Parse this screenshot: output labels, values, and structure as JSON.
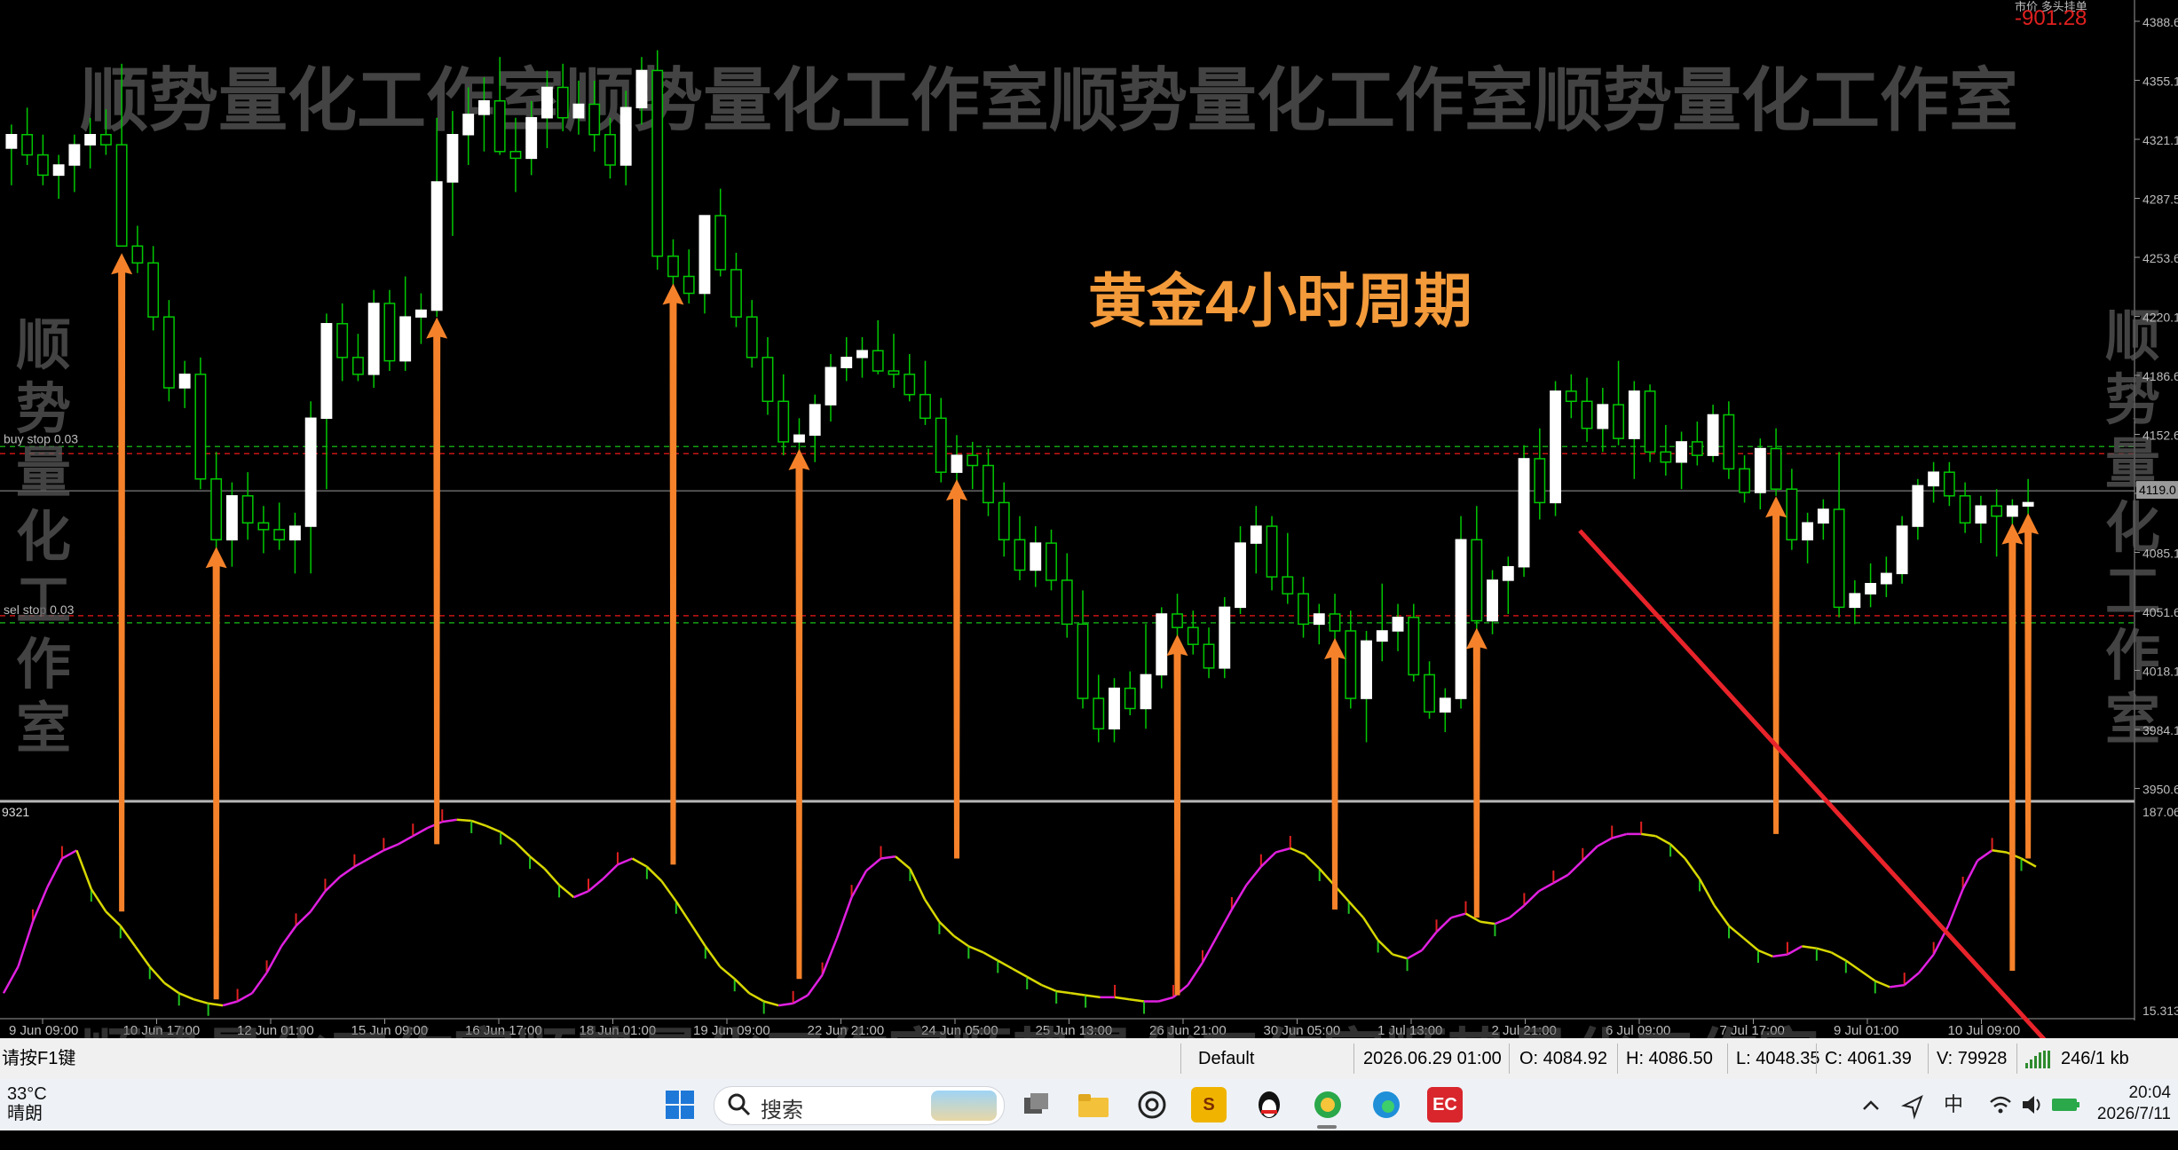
{
  "chart": {
    "title_annotation": "黄金4小时周期",
    "top_right_profit": "-901.28",
    "top_right_label": "市价 多头挂单",
    "order_lines": {
      "buy_stop": "buy stop 0.03",
      "sell_stop": "sel stop 0.03"
    },
    "indicator_label": "9321",
    "current_price_label": "4119.0",
    "watermark_text": "顺势量化工作室顺势量化工作室顺势量化工作室顺势量化工作室",
    "watermark_vertical_left": "顺势量化工作室",
    "watermark_vertical_right": "顺势量化工作室",
    "colors": {
      "bull": "#ffffff",
      "bear": "#00c800",
      "arrow": "#f5822a",
      "trend": "#e8232a",
      "ma_pink": "#e020e0",
      "ma_yellow": "#d7d700",
      "order_red": "#c81414",
      "order_green": "#14a014"
    }
  },
  "chart_data": {
    "type": "candlestick",
    "symbol": "黄金",
    "period": "H4",
    "price_axis_labels": [
      "4388.6",
      "4355.1",
      "4321.1",
      "4287.5",
      "4253.6",
      "4220.1",
      "4186.6",
      "4152.6",
      "4119.0",
      "4085.1",
      "4051.6",
      "4018.1",
      "3984.1",
      "3950.6"
    ],
    "indicator_axis_labels": [
      "187.06",
      "15.3137"
    ],
    "time_axis_labels": [
      "9 Jun 09:00",
      "10 Jun 17:00",
      "12 Jun 01:00",
      "15 Jun 09:00",
      "16 Jun 17:00",
      "18 Jun 01:00",
      "19 Jun 09:00",
      "22 Jun 21:00",
      "24 Jun 05:00",
      "25 Jun 13:00",
      "26 Jun 21:00",
      "30 Jun 05:00",
      "1 Jul 13:00",
      "2 Jul 21:00",
      "6 Jul 09:00",
      "7 Jul 17:00",
      "9 Jul 01:00",
      "10 Jul 09:00"
    ],
    "ylim": [
      3934,
      4394
    ],
    "current_price": 4119.0,
    "buy_stop_level": 4141.0,
    "sell_stop_level": 4045.0,
    "candles": [
      [
        4322,
        4336,
        4300,
        4330
      ],
      [
        4330,
        4346,
        4312,
        4318
      ],
      [
        4318,
        4330,
        4300,
        4306
      ],
      [
        4306,
        4318,
        4292,
        4312
      ],
      [
        4312,
        4330,
        4296,
        4324
      ],
      [
        4324,
        4340,
        4310,
        4330
      ],
      [
        4330,
        4345,
        4318,
        4324
      ],
      [
        4324,
        4372,
        4264,
        4264
      ],
      [
        4264,
        4276,
        4248,
        4254
      ],
      [
        4254,
        4264,
        4214,
        4222
      ],
      [
        4222,
        4232,
        4172,
        4180
      ],
      [
        4180,
        4196,
        4168,
        4188
      ],
      [
        4188,
        4198,
        4120,
        4126
      ],
      [
        4126,
        4142,
        4068,
        4090
      ],
      [
        4090,
        4124,
        4074,
        4116
      ],
      [
        4116,
        4130,
        4090,
        4100
      ],
      [
        4100,
        4110,
        4082,
        4096
      ],
      [
        4096,
        4112,
        4084,
        4090
      ],
      [
        4090,
        4106,
        4070,
        4098
      ],
      [
        4098,
        4172,
        4070,
        4162
      ],
      [
        4162,
        4224,
        4120,
        4218
      ],
      [
        4218,
        4230,
        4184,
        4198
      ],
      [
        4198,
        4212,
        4184,
        4188
      ],
      [
        4188,
        4238,
        4180,
        4230
      ],
      [
        4230,
        4238,
        4190,
        4196
      ],
      [
        4196,
        4246,
        4190,
        4222
      ],
      [
        4222,
        4236,
        4206,
        4226
      ],
      [
        4226,
        4340,
        4222,
        4302
      ],
      [
        4302,
        4344,
        4270,
        4330
      ],
      [
        4330,
        4358,
        4312,
        4342
      ],
      [
        4342,
        4364,
        4320,
        4350
      ],
      [
        4350,
        4376,
        4318,
        4320
      ],
      [
        4320,
        4340,
        4296,
        4316
      ],
      [
        4316,
        4350,
        4306,
        4340
      ],
      [
        4340,
        4368,
        4322,
        4358
      ],
      [
        4358,
        4372,
        4332,
        4340
      ],
      [
        4340,
        4362,
        4330,
        4348
      ],
      [
        4348,
        4362,
        4320,
        4330
      ],
      [
        4330,
        4340,
        4304,
        4312
      ],
      [
        4312,
        4356,
        4300,
        4346
      ],
      [
        4346,
        4376,
        4336,
        4368
      ],
      [
        4368,
        4380,
        4250,
        4258
      ],
      [
        4258,
        4268,
        4230,
        4246
      ],
      [
        4246,
        4262,
        4230,
        4236
      ],
      [
        4236,
        4268,
        4224,
        4282
      ],
      [
        4282,
        4298,
        4246,
        4250
      ],
      [
        4250,
        4260,
        4216,
        4222
      ],
      [
        4222,
        4232,
        4192,
        4198
      ],
      [
        4198,
        4210,
        4164,
        4172
      ],
      [
        4172,
        4188,
        4140,
        4148
      ],
      [
        4148,
        4162,
        4130,
        4152
      ],
      [
        4152,
        4176,
        4136,
        4170
      ],
      [
        4170,
        4200,
        4160,
        4192
      ],
      [
        4192,
        4210,
        4184,
        4198
      ],
      [
        4198,
        4210,
        4186,
        4202
      ],
      [
        4202,
        4220,
        4188,
        4190
      ],
      [
        4190,
        4212,
        4180,
        4188
      ],
      [
        4188,
        4200,
        4172,
        4176
      ],
      [
        4176,
        4196,
        4158,
        4162
      ],
      [
        4162,
        4174,
        4124,
        4130
      ],
      [
        4130,
        4152,
        4110,
        4140
      ],
      [
        4140,
        4148,
        4120,
        4134
      ],
      [
        4134,
        4144,
        4104,
        4112
      ],
      [
        4112,
        4124,
        4080,
        4090
      ],
      [
        4090,
        4104,
        4066,
        4072
      ],
      [
        4072,
        4098,
        4062,
        4088
      ],
      [
        4088,
        4096,
        4060,
        4066
      ],
      [
        4066,
        4082,
        4032,
        4040
      ],
      [
        4040,
        4060,
        3990,
        3996
      ],
      [
        3996,
        4010,
        3970,
        3978
      ],
      [
        3978,
        4008,
        3970,
        4002
      ],
      [
        4002,
        4012,
        3986,
        3990
      ],
      [
        3990,
        4040,
        3978,
        4010
      ],
      [
        4010,
        4050,
        4002,
        4046
      ],
      [
        4046,
        4058,
        4030,
        4038
      ],
      [
        4038,
        4048,
        4022,
        4028
      ],
      [
        4028,
        4038,
        4008,
        4014
      ],
      [
        4014,
        4056,
        4008,
        4050
      ],
      [
        4050,
        4098,
        4046,
        4088
      ],
      [
        4088,
        4110,
        4070,
        4098
      ],
      [
        4098,
        4104,
        4060,
        4068
      ],
      [
        4068,
        4094,
        4052,
        4058
      ],
      [
        4058,
        4068,
        4032,
        4040
      ],
      [
        4040,
        4052,
        4028,
        4046
      ],
      [
        4046,
        4058,
        4030,
        4036
      ],
      [
        4036,
        4048,
        3990,
        3996
      ],
      [
        3996,
        4036,
        3970,
        4030
      ],
      [
        4030,
        4064,
        4018,
        4036
      ],
      [
        4036,
        4052,
        4024,
        4044
      ],
      [
        4044,
        4052,
        4006,
        4010
      ],
      [
        4010,
        4018,
        3984,
        3988
      ],
      [
        3988,
        4002,
        3976,
        3996
      ],
      [
        3996,
        4104,
        3990,
        4090
      ],
      [
        4090,
        4110,
        4030,
        4042
      ],
      [
        4042,
        4072,
        4034,
        4066
      ],
      [
        4066,
        4080,
        4046,
        4074
      ],
      [
        4074,
        4146,
        4068,
        4138
      ],
      [
        4138,
        4156,
        4102,
        4112
      ],
      [
        4112,
        4184,
        4104,
        4178
      ],
      [
        4178,
        4188,
        4162,
        4172
      ],
      [
        4172,
        4186,
        4148,
        4156
      ],
      [
        4156,
        4180,
        4142,
        4170
      ],
      [
        4170,
        4196,
        4146,
        4150
      ],
      [
        4150,
        4184,
        4126,
        4178
      ],
      [
        4178,
        4182,
        4136,
        4142
      ],
      [
        4142,
        4158,
        4128,
        4136
      ],
      [
        4136,
        4154,
        4120,
        4148
      ],
      [
        4148,
        4160,
        4134,
        4140
      ],
      [
        4140,
        4170,
        4136,
        4164
      ],
      [
        4164,
        4172,
        4126,
        4132
      ],
      [
        4132,
        4140,
        4112,
        4118
      ],
      [
        4118,
        4150,
        4108,
        4144
      ],
      [
        4144,
        4156,
        4116,
        4120
      ],
      [
        4120,
        4132,
        4084,
        4090
      ],
      [
        4090,
        4106,
        4076,
        4100
      ],
      [
        4100,
        4114,
        4090,
        4108
      ],
      [
        4108,
        4142,
        4044,
        4050
      ],
      [
        4050,
        4066,
        4040,
        4058
      ],
      [
        4058,
        4076,
        4050,
        4064
      ],
      [
        4064,
        4080,
        4056,
        4070
      ],
      [
        4070,
        4104,
        4064,
        4098
      ],
      [
        4098,
        4126,
        4090,
        4122
      ],
      [
        4122,
        4136,
        4112,
        4130
      ],
      [
        4130,
        4136,
        4110,
        4116
      ],
      [
        4116,
        4124,
        4094,
        4100
      ],
      [
        4100,
        4116,
        4088,
        4110
      ],
      [
        4110,
        4120,
        4080,
        4104
      ],
      [
        4104,
        4114,
        4094,
        4110
      ],
      [
        4110,
        4126,
        4092,
        4112
      ]
    ],
    "indicator": {
      "name": "oscillator",
      "ylim": [
        0,
        200
      ],
      "values": [
        18,
        44,
        88,
        122,
        150,
        158,
        120,
        98,
        84,
        64,
        44,
        28,
        18,
        12,
        8,
        6,
        10,
        18,
        38,
        64,
        84,
        98,
        118,
        132,
        142,
        150,
        158,
        164,
        172,
        180,
        186,
        188,
        187,
        182,
        176,
        166,
        152,
        140,
        124,
        112,
        118,
        130,
        144,
        150,
        142,
        128,
        108,
        86,
        64,
        44,
        32,
        18,
        10,
        6,
        8,
        16,
        36,
        72,
        112,
        138,
        150,
        152,
        140,
        110,
        88,
        74,
        64,
        58,
        50,
        42,
        34,
        26,
        20,
        18,
        16,
        14,
        14,
        12,
        10,
        10,
        14,
        26,
        48,
        74,
        100,
        124,
        142,
        156,
        160,
        154,
        140,
        124,
        108,
        92,
        70,
        56,
        52,
        60,
        78,
        92,
        96,
        88,
        86,
        92,
        104,
        118,
        126,
        134,
        148,
        162,
        170,
        174,
        174,
        172,
        164,
        150,
        130,
        104,
        84,
        72,
        60,
        54,
        56,
        64,
        62,
        58,
        50,
        40,
        30,
        24,
        26,
        38,
        56,
        84,
        120,
        148,
        158,
        156,
        150,
        142
      ]
    }
  },
  "status_bar": {
    "help": "请按F1键",
    "profile": "Default",
    "datetime": "2026.06.29 01:00",
    "open": "O: 4084.92",
    "high": "H: 4086.50",
    "low": "L: 4048.35",
    "close": "C: 4061.39",
    "volume": "V: 79928",
    "traffic": "246/1 kb"
  },
  "taskbar": {
    "weather_temp": "33°C",
    "weather_text": "晴朗",
    "search_placeholder": "搜索",
    "ime": "中",
    "time": "20:04",
    "date": "2026/7/11",
    "ec_label": "EC",
    "file_label": "S"
  }
}
